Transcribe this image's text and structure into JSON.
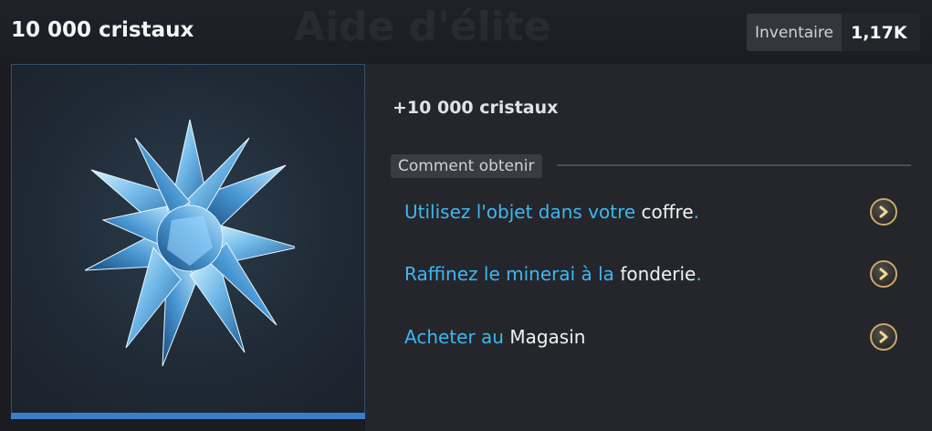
{
  "header": {
    "title": "10 000 cristaux",
    "background_ghost_title": "Aide d'élite",
    "inventory_label": "Inventaire",
    "inventory_value": "1,17K"
  },
  "item": {
    "icon": "blue-crystal-icon",
    "reward_text": "+10 000 cristaux"
  },
  "how_to_obtain": {
    "section_label": "Comment obtenir",
    "options": [
      {
        "prefix": "Utilisez l'objet dans votre ",
        "highlight": "coffre",
        "suffix": "."
      },
      {
        "prefix": "Raffinez le minerai à la ",
        "highlight": "fonderie",
        "suffix": "."
      },
      {
        "prefix": "Acheter au ",
        "highlight": "Magasin",
        "suffix": ""
      }
    ]
  },
  "colors": {
    "accent_blue": "#3fb7ef",
    "button_gold": "#c9a86a",
    "panel_border": "#3a7dcc"
  }
}
